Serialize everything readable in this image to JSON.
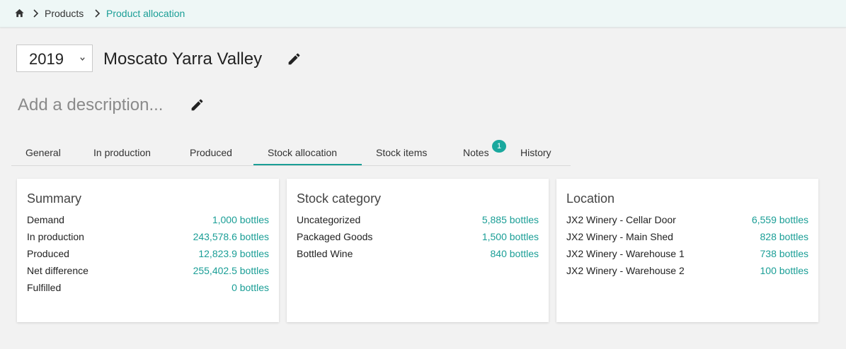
{
  "breadcrumb": {
    "home_icon": "home-icon",
    "items": [
      "Products",
      "Product allocation"
    ]
  },
  "header": {
    "year": "2019",
    "title": "Moscato Yarra Valley",
    "description_placeholder": "Add a description..."
  },
  "tabs": [
    {
      "label": "General"
    },
    {
      "label": "In production"
    },
    {
      "label": "Produced"
    },
    {
      "label": "Stock allocation",
      "active": true
    },
    {
      "label": "Stock items"
    },
    {
      "label": "Notes",
      "badge": "1"
    },
    {
      "label": "History"
    }
  ],
  "cards": {
    "summary": {
      "title": "Summary",
      "rows": [
        {
          "label": "Demand",
          "value": "1,000 bottles"
        },
        {
          "label": "In production",
          "value": "243,578.6 bottles"
        },
        {
          "label": "Produced",
          "value": "12,823.9 bottles"
        },
        {
          "label": "Net difference",
          "value": "255,402.5 bottles"
        },
        {
          "label": "Fulfilled",
          "value": "0 bottles"
        }
      ]
    },
    "stock_category": {
      "title": "Stock category",
      "rows": [
        {
          "label": "Uncategorized",
          "value": "5,885 bottles"
        },
        {
          "label": "Packaged Goods",
          "value": "1,500 bottles"
        },
        {
          "label": "Bottled Wine",
          "value": "840 bottles"
        }
      ]
    },
    "location": {
      "title": "Location",
      "rows": [
        {
          "label": "JX2 Winery - Cellar Door",
          "value": "6,559 bottles"
        },
        {
          "label": "JX2 Winery - Main Shed",
          "value": "828 bottles"
        },
        {
          "label": "JX2 Winery - Warehouse 1",
          "value": "738 bottles"
        },
        {
          "label": "JX2 Winery - Warehouse 2",
          "value": "100 bottles"
        }
      ]
    }
  },
  "colors": {
    "accent": "#1a9e96",
    "badge": "#1aa89e",
    "topbar": "#eef7f6",
    "background": "#f2f2f2"
  }
}
